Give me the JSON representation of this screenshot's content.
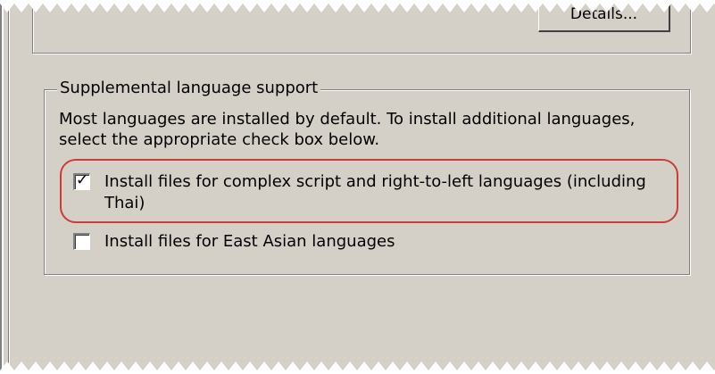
{
  "upper_group": {
    "details_button_label": "Details..."
  },
  "supplemental": {
    "legend": "Supplemental language support",
    "description": "Most languages are installed by default. To install additional languages, select the appropriate check box below.",
    "options": [
      {
        "label": "Install files for complex script and right-to-left languages (including Thai)",
        "checked": true
      },
      {
        "label": "Install files for East Asian languages",
        "checked": false
      }
    ]
  },
  "colors": {
    "dialog_bg": "#d4d0c8",
    "highlight_border": "#cc3a3a"
  }
}
